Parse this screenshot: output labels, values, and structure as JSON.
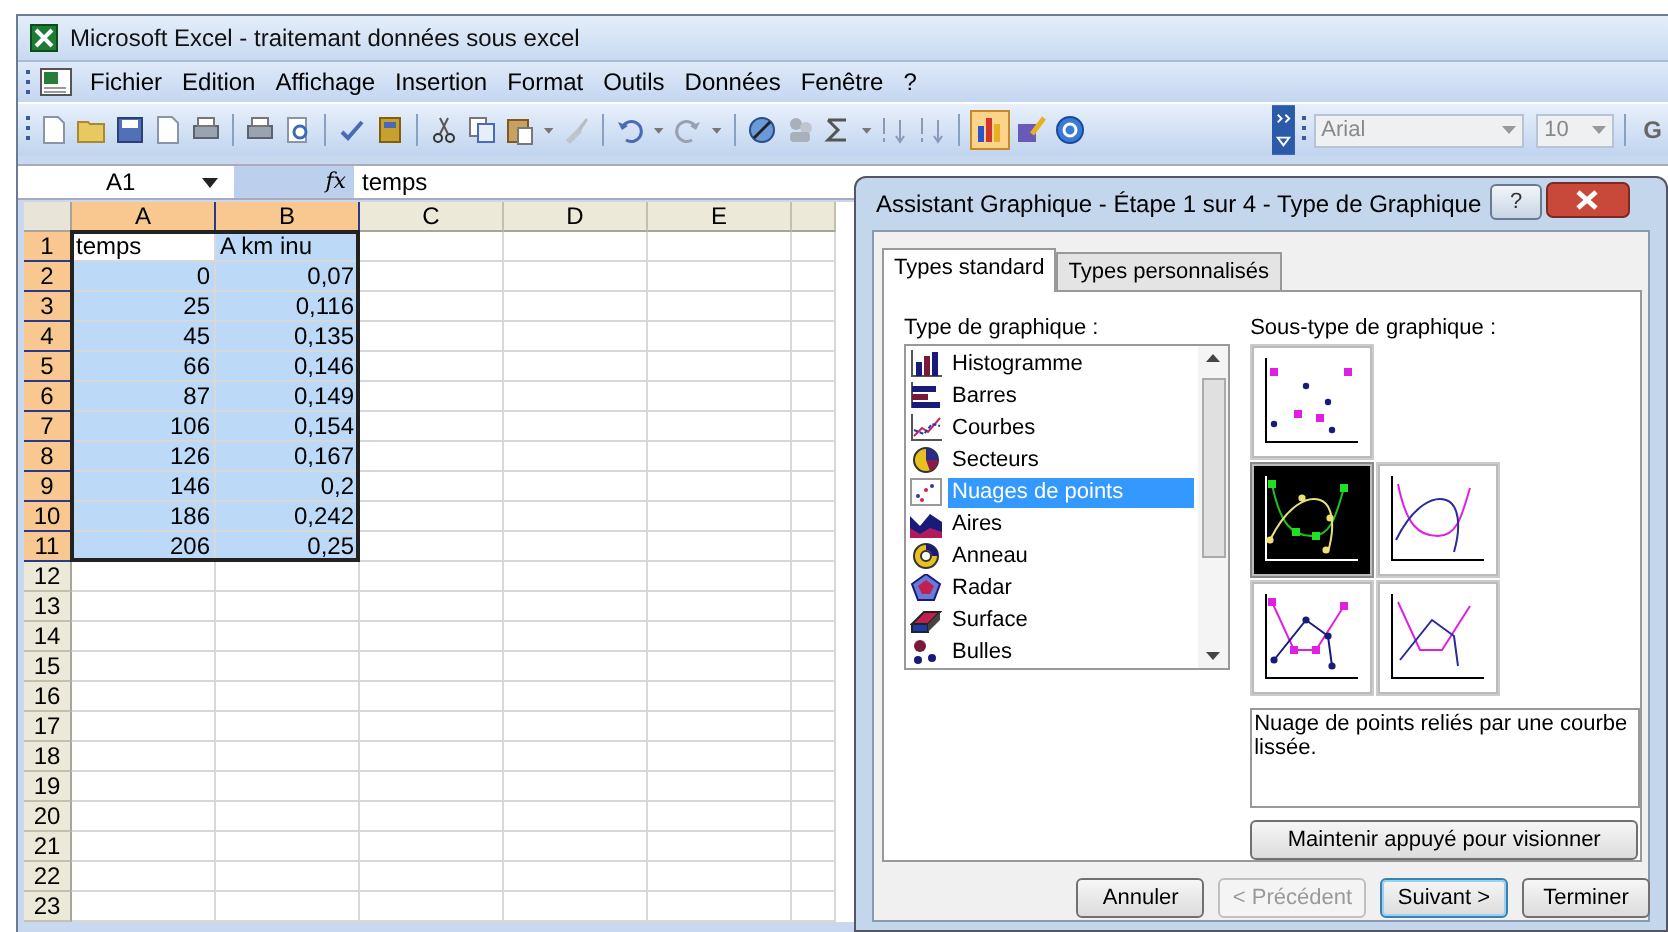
{
  "window": {
    "title": "Microsoft Excel - traitemant données sous excel"
  },
  "menu": [
    "Fichier",
    "Edition",
    "Affichage",
    "Insertion",
    "Format",
    "Outils",
    "Données",
    "Fenêtre",
    "?"
  ],
  "toolbar": {
    "font": "Arial",
    "size": "10",
    "bold_label": "G"
  },
  "formula_bar": {
    "name_box": "A1",
    "fx": "fx",
    "value": "temps"
  },
  "sheet": {
    "columns": [
      {
        "label": "A",
        "selected": true
      },
      {
        "label": "B",
        "selected": true
      },
      {
        "label": "C",
        "selected": false
      },
      {
        "label": "D",
        "selected": false
      },
      {
        "label": "E",
        "selected": false
      }
    ],
    "rows": [
      {
        "label": "1",
        "selected": true,
        "cells": [
          {
            "text": "temps",
            "kind": "text",
            "selected": false
          },
          {
            "text": "A km inu",
            "kind": "text",
            "selected": true
          }
        ]
      },
      {
        "label": "2",
        "selected": true,
        "cells": [
          {
            "text": "0",
            "kind": "number",
            "selected": true
          },
          {
            "text": "0,07",
            "kind": "number",
            "selected": true
          }
        ]
      },
      {
        "label": "3",
        "selected": true,
        "cells": [
          {
            "text": "25",
            "kind": "number",
            "selected": true
          },
          {
            "text": "0,116",
            "kind": "number",
            "selected": true
          }
        ]
      },
      {
        "label": "4",
        "selected": true,
        "cells": [
          {
            "text": "45",
            "kind": "number",
            "selected": true
          },
          {
            "text": "0,135",
            "kind": "number",
            "selected": true
          }
        ]
      },
      {
        "label": "5",
        "selected": true,
        "cells": [
          {
            "text": "66",
            "kind": "number",
            "selected": true
          },
          {
            "text": "0,146",
            "kind": "number",
            "selected": true
          }
        ]
      },
      {
        "label": "6",
        "selected": true,
        "cells": [
          {
            "text": "87",
            "kind": "number",
            "selected": true
          },
          {
            "text": "0,149",
            "kind": "number",
            "selected": true
          }
        ]
      },
      {
        "label": "7",
        "selected": true,
        "cells": [
          {
            "text": "106",
            "kind": "number",
            "selected": true
          },
          {
            "text": "0,154",
            "kind": "number",
            "selected": true
          }
        ]
      },
      {
        "label": "8",
        "selected": true,
        "cells": [
          {
            "text": "126",
            "kind": "number",
            "selected": true
          },
          {
            "text": "0,167",
            "kind": "number",
            "selected": true
          }
        ]
      },
      {
        "label": "9",
        "selected": true,
        "cells": [
          {
            "text": "146",
            "kind": "number",
            "selected": true
          },
          {
            "text": "0,2",
            "kind": "number",
            "selected": true
          }
        ]
      },
      {
        "label": "10",
        "selected": true,
        "cells": [
          {
            "text": "186",
            "kind": "number",
            "selected": true
          },
          {
            "text": "0,242",
            "kind": "number",
            "selected": true
          }
        ]
      },
      {
        "label": "11",
        "selected": true,
        "cells": [
          {
            "text": "206",
            "kind": "number",
            "selected": true
          },
          {
            "text": "0,25",
            "kind": "number",
            "selected": true
          }
        ]
      },
      {
        "label": "12",
        "selected": false
      },
      {
        "label": "13",
        "selected": false
      },
      {
        "label": "14",
        "selected": false
      },
      {
        "label": "15",
        "selected": false
      },
      {
        "label": "16",
        "selected": false
      },
      {
        "label": "17",
        "selected": false
      },
      {
        "label": "18",
        "selected": false
      },
      {
        "label": "19",
        "selected": false
      },
      {
        "label": "20",
        "selected": false
      },
      {
        "label": "21",
        "selected": false
      },
      {
        "label": "22",
        "selected": false
      },
      {
        "label": "23",
        "selected": false
      }
    ]
  },
  "dialog": {
    "title": "Assistant Graphique - Étape 1 sur 4 - Type de Graphique",
    "help": "?",
    "tabs": [
      {
        "label": "Types standard",
        "selected": true
      },
      {
        "label": "Types personnalisés",
        "selected": false
      }
    ],
    "type_label": "Type de graphique :",
    "chart_types": [
      {
        "label": "Histogramme",
        "selected": false
      },
      {
        "label": "Barres",
        "selected": false
      },
      {
        "label": "Courbes",
        "selected": false
      },
      {
        "label": "Secteurs",
        "selected": false
      },
      {
        "label": "Nuages de points",
        "selected": true
      },
      {
        "label": "Aires",
        "selected": false
      },
      {
        "label": "Anneau",
        "selected": false
      },
      {
        "label": "Radar",
        "selected": false
      },
      {
        "label": "Surface",
        "selected": false
      },
      {
        "label": "Bulles",
        "selected": false
      }
    ],
    "subtype_label": "Sous-type de graphique :",
    "subtypes": [
      {
        "kind": "markers",
        "selected": false
      },
      {
        "kind": "smooth-markers",
        "selected": true
      },
      {
        "kind": "smooth",
        "selected": false
      },
      {
        "kind": "lines-markers",
        "selected": false
      },
      {
        "kind": "lines",
        "selected": false
      }
    ],
    "description": "Nuage de points reliés par une courbe lissée.",
    "preview_button": "Maintenir appuyé pour visionner",
    "buttons": [
      {
        "label": "Annuler",
        "disabled": false,
        "default": false
      },
      {
        "label": "< Précédent",
        "disabled": true,
        "default": false
      },
      {
        "label": "Suivant >",
        "disabled": false,
        "default": true
      },
      {
        "label": "Terminer",
        "disabled": false,
        "default": false
      }
    ]
  }
}
